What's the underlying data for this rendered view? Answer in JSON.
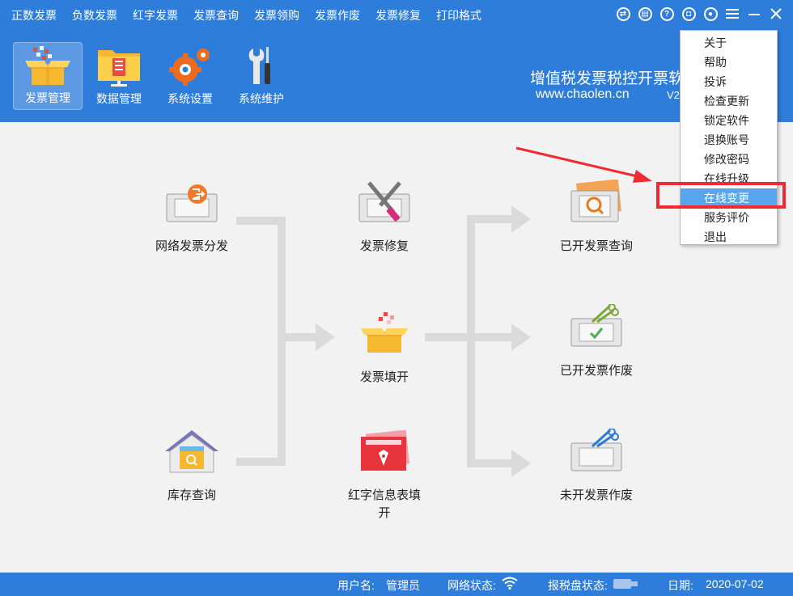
{
  "top_menu": [
    "正数发票",
    "负数发票",
    "红字发票",
    "发票查询",
    "发票领购",
    "发票作废",
    "发票修复",
    "打印格式"
  ],
  "toolbar": [
    {
      "label": "发票管理",
      "active": true
    },
    {
      "label": "数据管理",
      "active": false
    },
    {
      "label": "系统设置",
      "active": false
    },
    {
      "label": "系统维护",
      "active": false
    }
  ],
  "brand": {
    "title": "增值税发票税控开票软",
    "url": "www.chaolen.cn",
    "version": "V2"
  },
  "flow": {
    "network_dist": "网络发票分发",
    "invoice_repair": "发票修复",
    "issued_query": "已开发票查询",
    "invoice_fill": "发票填开",
    "issued_void": "已开发票作废",
    "stock_query": "库存查询",
    "red_info_fill": "红字信息表填\n开",
    "unissued_void": "未开发票作废"
  },
  "dropdown": {
    "items": [
      "关于",
      "帮助",
      "投诉",
      "检查更新",
      "锁定软件",
      "退换账号",
      "修改密码",
      "在线升级",
      "在线变更",
      "服务评价",
      "退出"
    ],
    "highlighted": "在线变更"
  },
  "status": {
    "user_label": "用户名:",
    "user_value": "管理员",
    "network_label": "网络状态:",
    "taxdisk_label": "报税盘状态:",
    "date_label": "日期:",
    "date_value": "2020-07-02"
  },
  "colors": {
    "header_blue": "#2f7ddb",
    "highlight_blue": "#5aa4ec",
    "annotation_red": "#ee2b33"
  }
}
